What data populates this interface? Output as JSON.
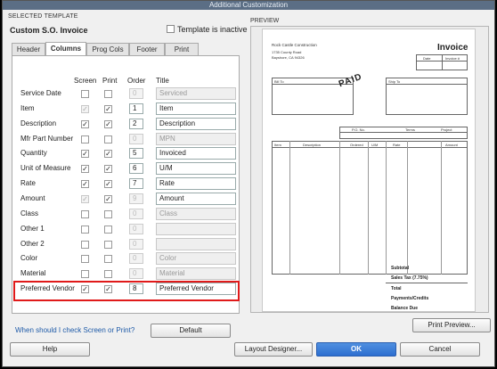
{
  "window": {
    "title": "Additional Customization"
  },
  "template": {
    "group_label": "SELECTED TEMPLATE",
    "name": "Custom S.O. Invoice",
    "inactive_label": "Template is inactive"
  },
  "tabs": [
    {
      "label": "Header",
      "active": false
    },
    {
      "label": "Columns",
      "active": true
    },
    {
      "label": "Prog Cols",
      "active": false
    },
    {
      "label": "Footer",
      "active": false
    },
    {
      "label": "Print",
      "active": false
    }
  ],
  "column_headers": {
    "screen": "Screen",
    "print": "Print",
    "order": "Order",
    "title": "Title"
  },
  "rows": [
    {
      "label": "Service Date",
      "screen": false,
      "print": false,
      "order": "0",
      "title": "Serviced",
      "screen_disabled": false,
      "order_disabled": true
    },
    {
      "label": "Item",
      "screen": true,
      "print": true,
      "order": "1",
      "title": "Item",
      "screen_disabled": true,
      "order_disabled": false
    },
    {
      "label": "Description",
      "screen": true,
      "print": true,
      "order": "2",
      "title": "Description",
      "screen_disabled": false,
      "order_disabled": false
    },
    {
      "label": "Mfr Part Number",
      "screen": false,
      "print": false,
      "order": "0",
      "title": "MPN",
      "screen_disabled": false,
      "order_disabled": true
    },
    {
      "label": "Quantity",
      "screen": true,
      "print": true,
      "order": "5",
      "title": "Invoiced",
      "screen_disabled": false,
      "order_disabled": false
    },
    {
      "label": "Unit of Measure",
      "screen": true,
      "print": true,
      "order": "6",
      "title": "U/M",
      "screen_disabled": false,
      "order_disabled": false
    },
    {
      "label": "Rate",
      "screen": true,
      "print": true,
      "order": "7",
      "title": "Rate",
      "screen_disabled": false,
      "order_disabled": false
    },
    {
      "label": "Amount",
      "screen": true,
      "print": true,
      "order": "9",
      "title": "Amount",
      "screen_disabled": true,
      "order_disabled": true
    },
    {
      "label": "Class",
      "screen": false,
      "print": false,
      "order": "0",
      "title": "Class",
      "screen_disabled": false,
      "order_disabled": true
    },
    {
      "label": "Other 1",
      "screen": false,
      "print": false,
      "order": "0",
      "title": "",
      "screen_disabled": false,
      "order_disabled": true
    },
    {
      "label": "Other 2",
      "screen": false,
      "print": false,
      "order": "0",
      "title": "",
      "screen_disabled": false,
      "order_disabled": true
    },
    {
      "label": "Color",
      "screen": false,
      "print": false,
      "order": "0",
      "title": "Color",
      "screen_disabled": false,
      "order_disabled": true
    },
    {
      "label": "Material",
      "screen": false,
      "print": false,
      "order": "0",
      "title": "Material",
      "screen_disabled": false,
      "order_disabled": true
    },
    {
      "label": "Preferred Vendor",
      "screen": true,
      "print": true,
      "order": "8",
      "title": "Preferred Vendor",
      "screen_disabled": false,
      "order_disabled": false
    }
  ],
  "help_link": "When should I check Screen or Print?",
  "buttons": {
    "default": "Default",
    "print_preview": "Print Preview...",
    "help": "Help",
    "layout_designer": "Layout Designer...",
    "ok": "OK",
    "cancel": "Cancel"
  },
  "preview": {
    "label": "PREVIEW",
    "company": "Rock Castle Construction",
    "address_1": "1735 County Road",
    "address_2": "Bayshore, CA 94326",
    "doc_title": "Invoice",
    "date_head": "Date",
    "invoice_head": "Invoice #",
    "bill_to": "Bill To",
    "ship_to": "Ship To",
    "stamp": "PAID",
    "po_no": "P.O. No.",
    "terms": "Terms",
    "project": "Project",
    "col_item": "Item",
    "col_desc": "Description",
    "col_qty": "Ordered",
    "col_uom": "U/M",
    "col_rate": "Rate",
    "col_amount": "Amount",
    "subtotal": "Subtotal",
    "sales_tax": "Sales Tax (7.75%)",
    "total": "Total",
    "payments": "Payments/Credits",
    "balance": "Balance Due"
  }
}
